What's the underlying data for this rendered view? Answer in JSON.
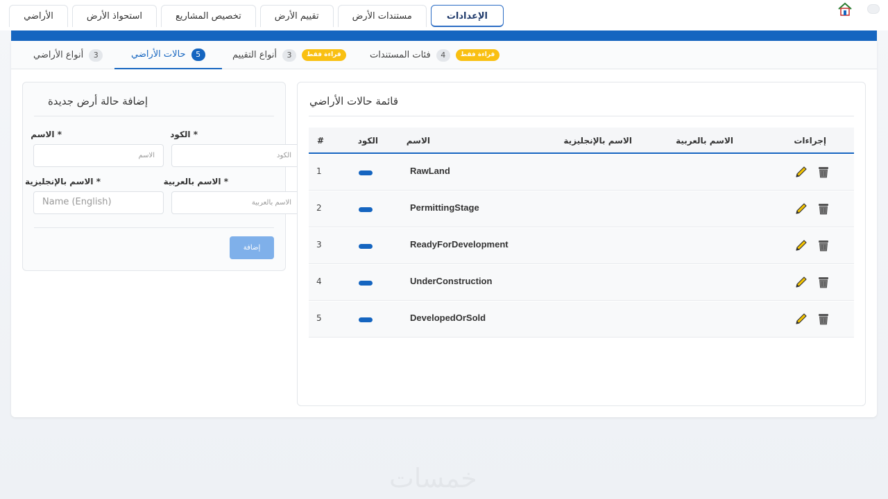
{
  "top_tabs": [
    {
      "label": "الإعدادات",
      "active": true
    },
    {
      "label": "مستندات الأرض",
      "active": false
    },
    {
      "label": "تقييم الأرض",
      "active": false
    },
    {
      "label": "تخصيص المشاريع",
      "active": false
    },
    {
      "label": "استحواذ الأرض",
      "active": false
    },
    {
      "label": "الأراضي",
      "active": false
    }
  ],
  "sub_tabs": [
    {
      "label": "فئات المستندات",
      "count": "4",
      "badge": "قراءة فقط",
      "active": false
    },
    {
      "label": "أنواع التقييم",
      "count": "3",
      "badge": "قراءة فقط",
      "active": false
    },
    {
      "label": "حالات الأراضي",
      "count": "5",
      "badge": "",
      "active": true
    },
    {
      "label": "أنواع الأراضي",
      "count": "3",
      "badge": "",
      "active": false
    }
  ],
  "form": {
    "title": "إضافة حالة أرض جديدة",
    "code_label": "* الكود",
    "code_placeholder": "الكود",
    "name_label": "* الاسم",
    "name_placeholder": "الاسم",
    "name_ar_label": "* الاسم بالعربية",
    "name_ar_placeholder": "الاسم بالعربية",
    "name_en_label": "* الاسم بالإنجليزية",
    "name_en_placeholder": "Name (English)",
    "add_button": "إضافة"
  },
  "list": {
    "title": "قائمة حالات الأراضي",
    "columns": {
      "actions": "إجراءات",
      "name_ar": "الاسم بالعربية",
      "name_en": "الاسم بالإنجليزية",
      "name": "الاسم",
      "code": "الكود",
      "index": "#"
    },
    "rows": [
      {
        "index": "1",
        "name": "RawLand"
      },
      {
        "index": "2",
        "name": "PermittingStage"
      },
      {
        "index": "3",
        "name": "ReadyForDevelopment"
      },
      {
        "index": "4",
        "name": "UnderConstruction"
      },
      {
        "index": "5",
        "name": "DevelopedOrSold"
      }
    ]
  },
  "watermark": "خمسات",
  "colors": {
    "primary": "#1565c0",
    "badge_yellow": "#f9c012",
    "edit_icon": "#e0a800",
    "delete_icon": "#6b6b6b"
  }
}
